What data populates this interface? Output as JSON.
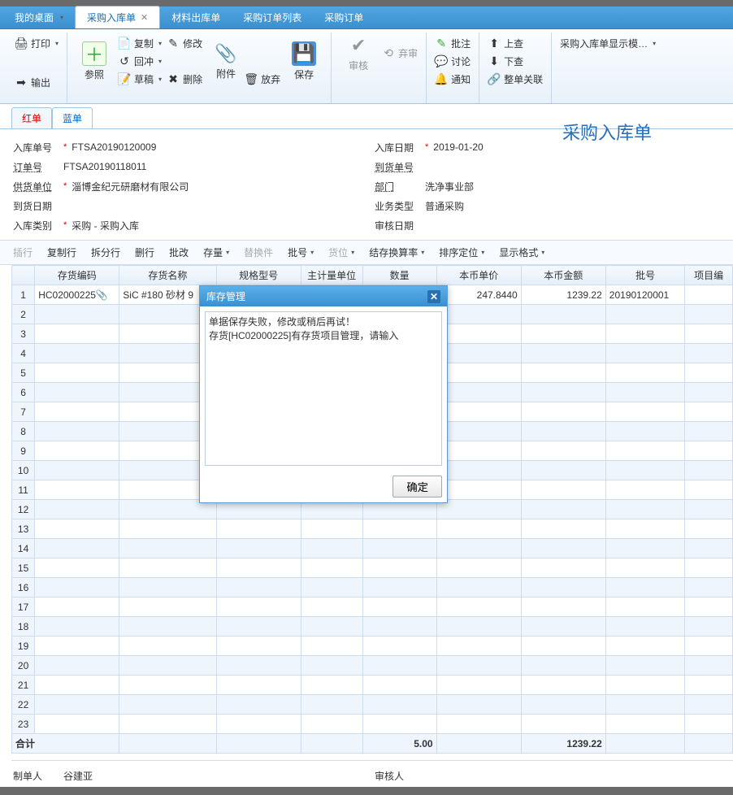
{
  "tabs": {
    "desktop": "我的桌面",
    "purchase_in": "采购入库单",
    "material_out": "材料出库单",
    "po_list": "采购订单列表",
    "po": "采购订单"
  },
  "ribbon": {
    "print": "打印",
    "output": "输出",
    "ref": "参照",
    "copy": "复制",
    "undo": "回冲",
    "draft": "草稿",
    "modify": "修改",
    "delete": "删除",
    "attach": "附件",
    "discard": "放弃",
    "save": "保存",
    "audit": "审核",
    "reject": "弃审",
    "approve": "批注",
    "discuss": "讨论",
    "notify": "通知",
    "up": "上查",
    "down": "下查",
    "link": "整单关联",
    "display_mode": "采购入库单显示模…"
  },
  "doctabs": {
    "red": "红单",
    "blue": "蓝单"
  },
  "title": "采购入库单",
  "form": {
    "in_no_label": "入库单号",
    "in_no": "FTSA20190120009",
    "in_date_label": "入库日期",
    "in_date": "2019-01-20",
    "order_no_label": "订单号",
    "order_no": "FTSA20190118011",
    "arrive_no_label": "到货单号",
    "arrive_no": "",
    "supplier_label": "供货单位",
    "supplier": "淄博金纪元研磨材有限公司",
    "dept_label": "部门",
    "dept": "洗净事业部",
    "arrive_date_label": "到货日期",
    "arrive_date": "",
    "biz_type_label": "业务类型",
    "biz_type": "普通采购",
    "in_type_label": "入库类别",
    "in_type": "采购 - 采购入库",
    "audit_date_label": "审核日期",
    "audit_date": ""
  },
  "gridbar": {
    "insert": "插行",
    "copy_row": "复制行",
    "split_row": "拆分行",
    "del_row": "删行",
    "batch_mod": "批改",
    "stock": "存量",
    "replace": "替换件",
    "batch_no": "批号",
    "loc": "货位",
    "convert": "结存换算率",
    "sort": "排序定位",
    "disp": "显示格式"
  },
  "columns": {
    "inv_code": "存货编码",
    "inv_name": "存货名称",
    "spec": "规格型号",
    "unit": "主计量单位",
    "qty": "数量",
    "price": "本币单价",
    "amount": "本币金额",
    "batch": "批号",
    "project": "项目编"
  },
  "rows": [
    {
      "inv_code": "HC02000225",
      "inv_name": "SiC #180 砂材 9",
      "spec": "",
      "unit": "",
      "qty": "",
      "price": "247.8440",
      "amount": "1239.22",
      "batch": "20190120001"
    }
  ],
  "totals": {
    "label": "合计",
    "qty": "5.00",
    "amount": "1239.22"
  },
  "footer": {
    "maker_label": "制单人",
    "maker": "谷建亚",
    "auditor_label": "审核人",
    "auditor": ""
  },
  "dialog": {
    "title": "库存管理",
    "line1": "单据保存失败，修改或稍后再试！",
    "line2": "存货[HC02000225]有存货项目管理，请输入",
    "ok": "确定"
  }
}
